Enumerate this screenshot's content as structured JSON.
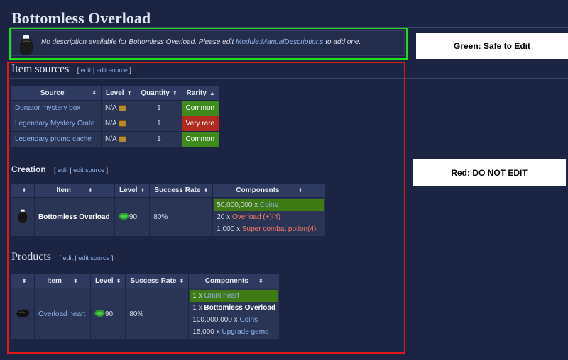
{
  "page": {
    "title": "Bottomless Overload",
    "description_prefix": "No description available for Bottomless Overload. Please edit ",
    "description_link": "Module:ManualDescriptions",
    "description_suffix": " to add one."
  },
  "callouts": {
    "green": "Green: Safe to Edit",
    "red": "Red: DO NOT EDIT"
  },
  "edit_links": {
    "edit": "edit",
    "sep": "|",
    "edit_source": "edit source",
    "open": "[",
    "close": "]"
  },
  "item_sources": {
    "heading": "Item sources",
    "columns": [
      "Source",
      "Level",
      "Quantity",
      "Rarity"
    ],
    "rows": [
      {
        "source": "Donator mystery box",
        "level": "N/A",
        "quantity": "1",
        "rarity": "Common"
      },
      {
        "source": "Legendary Mystery Crate",
        "level": "N/A",
        "quantity": "1",
        "rarity": "Very rare"
      },
      {
        "source": "Legendary promo cache",
        "level": "N/A",
        "quantity": "1",
        "rarity": "Common"
      }
    ]
  },
  "creation": {
    "heading": "Creation",
    "columns": [
      "",
      "Item",
      "Level",
      "Success Rate",
      "Components"
    ],
    "row": {
      "item": "Bottomless Overload",
      "level": "90",
      "success_rate": "80%",
      "components": [
        {
          "qty": "50,000,000 x",
          "name": "Coins"
        },
        {
          "qty": "20 x",
          "name": "Overload (+)(4)"
        },
        {
          "qty": "1,000 x",
          "name": "Super combat potion(4)"
        }
      ]
    }
  },
  "products": {
    "heading": "Products",
    "columns": [
      "",
      "Item",
      "Level",
      "Success Rate",
      "Components"
    ],
    "row": {
      "item": "Overload heart",
      "level": "90",
      "success_rate": "80%",
      "components": [
        {
          "qty": "1 x",
          "name": "Omni heart"
        },
        {
          "qty": "1 x",
          "name": "Bottomless Overload"
        },
        {
          "qty": "100,000,000 x",
          "name": "Coins"
        },
        {
          "qty": "15,000 x",
          "name": "Upgrade gems"
        }
      ]
    }
  },
  "colors": {
    "background": "#1b2442",
    "green_outline": "#1fdc1f",
    "red_outline": "#e01818",
    "link": "#8eb4ef",
    "common": "#3f8a1d",
    "very_rare": "#b02a20"
  },
  "icons": {
    "item": "bottomless-overload-icon",
    "product": "overload-heart-icon",
    "chest": "chest-icon",
    "herb": "herblore-icon",
    "sort": "sort-arrows-icon"
  }
}
